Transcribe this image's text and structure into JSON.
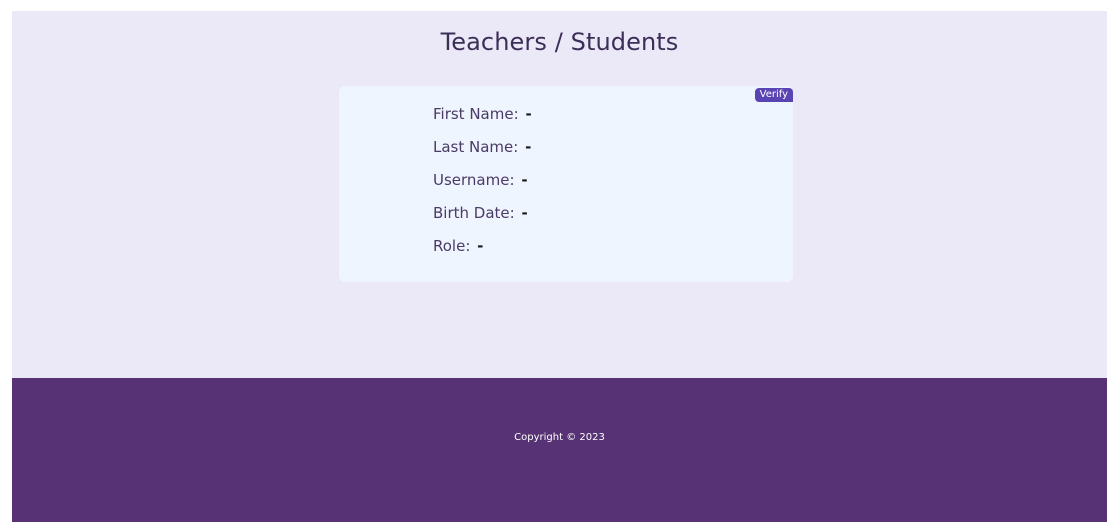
{
  "page": {
    "title": "Teachers / Students"
  },
  "card": {
    "verify_label": "Verify",
    "fields": [
      {
        "label": "First Name:",
        "value": "-"
      },
      {
        "label": "Last Name:",
        "value": "-"
      },
      {
        "label": "Username:",
        "value": "-"
      },
      {
        "label": "Birth Date:",
        "value": "-"
      },
      {
        "label": "Role:",
        "value": "-"
      }
    ]
  },
  "footer": {
    "copyright": "Copyright © 2023"
  },
  "colors": {
    "page_background": "#ebe8f7",
    "card_background": "#eff5ff",
    "accent": "#5a43b3",
    "footer_background": "#573274"
  }
}
